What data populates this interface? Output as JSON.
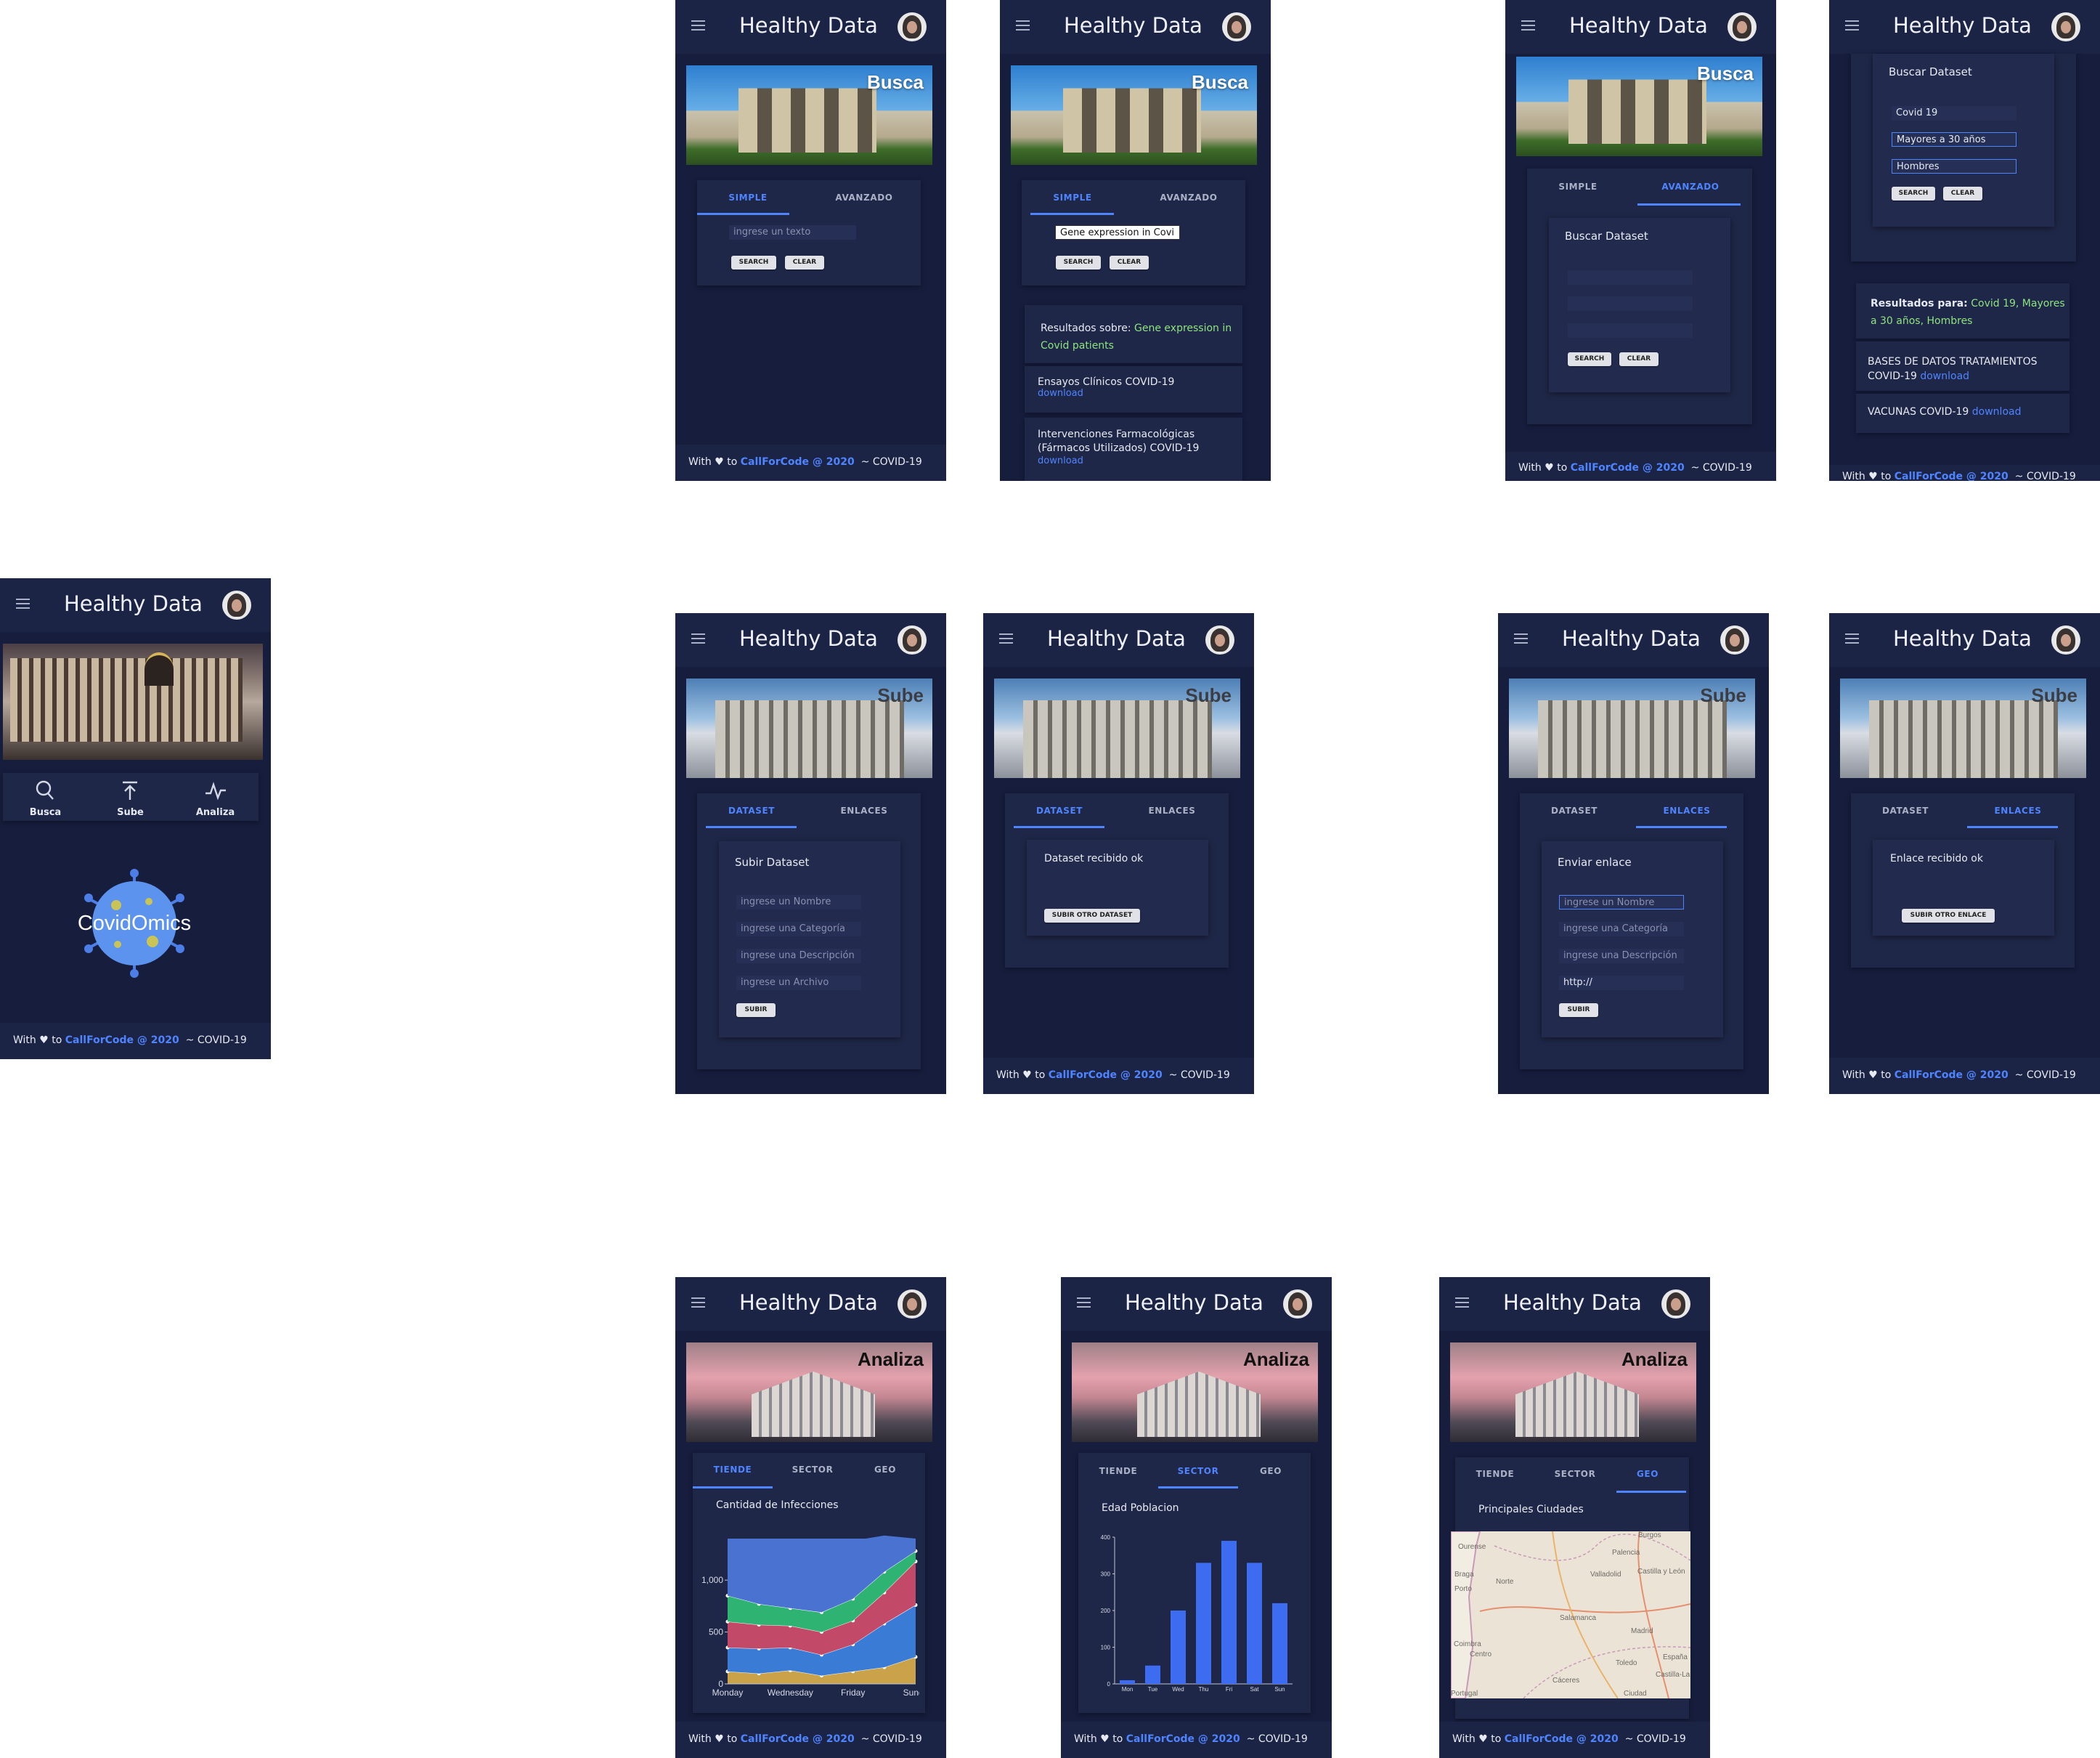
{
  "app": {
    "title": "Healthy Data"
  },
  "footer": {
    "with": "With",
    "heart": "♥",
    "to": "to",
    "link": "CallForCode @ 2020",
    "suffix": "~ COVID-19"
  },
  "banners": {
    "busca": "Busca",
    "sube": "Sube",
    "analiza": "Analiza"
  },
  "home": {
    "nav": [
      {
        "label": "Busca",
        "icon": "search-icon"
      },
      {
        "label": "Sube",
        "icon": "upload-icon"
      },
      {
        "label": "Analiza",
        "icon": "pulse-icon"
      }
    ],
    "logo_text": "CovidOmics"
  },
  "busca": {
    "tabs": {
      "simple": "SIMPLE",
      "avanzado": "AVANZADO"
    },
    "simple_placeholder": "ingrese un texto",
    "simple_value": "Gene expression in Covi",
    "search": "SEARCH",
    "clear": "CLEAR",
    "results_label": "Resultados sobre:",
    "results_query": "Gene expression in Covid patients",
    "results": [
      {
        "title": "Ensayos Clínicos COVID-19",
        "link": "download"
      },
      {
        "title": "Intervenciones Farmacológicas (Fármacos Utilizados) COVID-19",
        "link": "download"
      }
    ],
    "adv_title": "Buscar Dataset",
    "adv_values": [
      "Covid 19",
      "Mayores a 30 años",
      "Hombres"
    ],
    "adv_results_label": "Resultados para:",
    "adv_results_query": "Covid 19, Mayores a 30 años, Hombres",
    "adv_results": [
      {
        "title": "BASES DE DATOS TRATAMIENTOS COVID-19",
        "link": "download"
      },
      {
        "title": "VACUNAS COVID-19",
        "link": "download"
      }
    ]
  },
  "sube": {
    "tabs": {
      "dataset": "DATASET",
      "enlaces": "ENLACES"
    },
    "dataset_title": "Subir Dataset",
    "dataset_fields": [
      "ingrese un Nombre",
      "ingrese una Categoría",
      "ingrese una Descripción",
      "ingrese un Archivo"
    ],
    "submit": "SUBIR",
    "dataset_ok": "Dataset recibido ok",
    "dataset_again": "SUBIR OTRO DATASET",
    "link_title": "Enviar enlace",
    "link_fields": [
      "ingrese un Nombre",
      "ingrese una Categoría",
      "ingrese una Descripción",
      "http://"
    ],
    "link_ok": "Enlace recibido ok",
    "link_again": "SUBIR OTRO ENLACE"
  },
  "analiza": {
    "tabs": {
      "tiende": "TIENDE",
      "sector": "SECTOR",
      "geo": "GEO"
    },
    "tiende_title": "Cantidad de Infecciones",
    "sector_title": "Edad Poblacion",
    "geo_title": "Principales Ciudades",
    "map_labels": [
      "Ourense",
      "Burgos",
      "Palencia",
      "Valladolid",
      "Castilla y León",
      "Braga",
      "Norte",
      "Porto",
      "Salamanca",
      "Madrid",
      "Coimbra",
      "Centro",
      "Toledo",
      "España",
      "Castilla-La Mancha",
      "Cáceres",
      "Portugal",
      "Ciudad"
    ]
  },
  "chart_data": [
    {
      "type": "area",
      "title": "Cantidad de Infecciones",
      "categories": [
        "Monday",
        "Tuesday",
        "Wednesday",
        "Thursday",
        "Friday",
        "Saturday",
        "Sunday"
      ],
      "tick_labels_x": [
        "Monday",
        "Wednesday",
        "Friday",
        "Sunda"
      ],
      "ylim": [
        0,
        1400
      ],
      "yticks": [
        "0",
        "500",
        "1,000"
      ],
      "stacked": true,
      "series": [
        {
          "color": "#c9a24a",
          "values": [
            120,
            100,
            130,
            80,
            120,
            160,
            260
          ]
        },
        {
          "color": "#3a7bd5",
          "values": [
            230,
            240,
            220,
            200,
            260,
            420,
            500
          ]
        },
        {
          "color": "#c24a68",
          "values": [
            250,
            230,
            210,
            220,
            230,
            300,
            420
          ]
        },
        {
          "color": "#2fb372",
          "values": [
            250,
            200,
            170,
            190,
            210,
            200,
            100
          ]
        },
        {
          "color": "#4a72d0",
          "values": [
            500,
            580,
            650,
            600,
            560,
            350,
            120
          ]
        }
      ]
    },
    {
      "type": "bar",
      "title": "Edad Poblacion",
      "categories": [
        "Mon",
        "Tue",
        "Wed",
        "Thu",
        "Fri",
        "Sat",
        "Sun"
      ],
      "values": [
        10,
        50,
        200,
        330,
        390,
        330,
        220
      ],
      "ylim": [
        0,
        400
      ],
      "yticks": [
        "0",
        "100",
        "200",
        "300",
        "400"
      ],
      "color": "#3e6cf0"
    }
  ]
}
